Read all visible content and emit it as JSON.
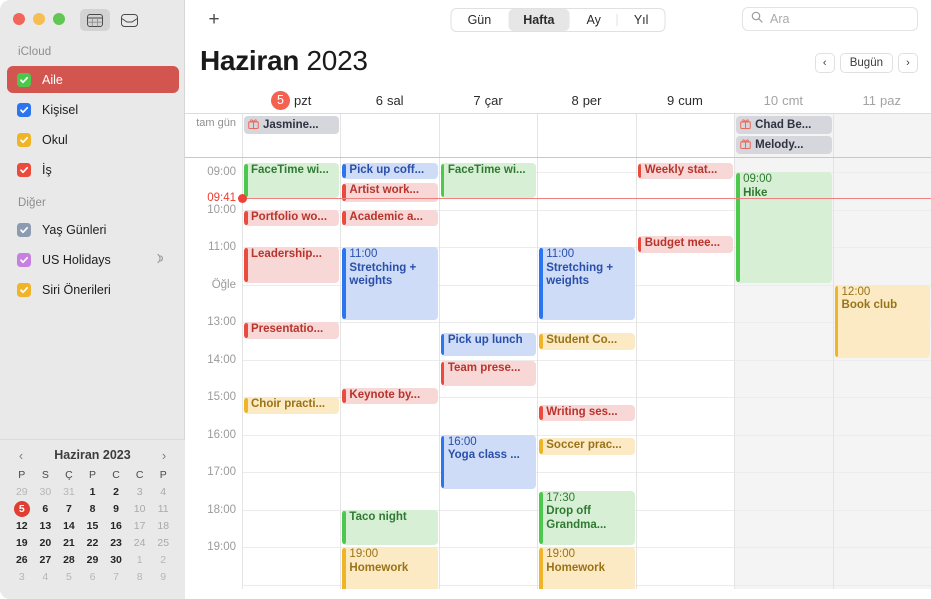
{
  "window": {
    "traffic_lights": [
      "close",
      "minimize",
      "zoom"
    ],
    "toolbar_buttons": [
      "calendar-view-icon",
      "inbox-icon"
    ]
  },
  "sidebar": {
    "sections": [
      {
        "title": "iCloud",
        "items": [
          {
            "label": "Aile",
            "color": "#4cc94c",
            "checked": true,
            "selected": true
          },
          {
            "label": "Kişisel",
            "color": "#2b76f0",
            "checked": true,
            "selected": false
          },
          {
            "label": "Okul",
            "color": "#f0b429",
            "checked": true,
            "selected": false
          },
          {
            "label": "İş",
            "color": "#ea4b3c",
            "checked": true,
            "selected": false
          }
        ]
      },
      {
        "title": "Diğer",
        "items": [
          {
            "label": "Yaş Günleri",
            "color": "#8c9bb0",
            "checked": true,
            "selected": false
          },
          {
            "label": "US Holidays",
            "color": "#c77fe0",
            "checked": true,
            "selected": false,
            "badge": "broadcast-icon"
          },
          {
            "label": "Siri Önerileri",
            "color": "#f0b429",
            "checked": true,
            "selected": false
          }
        ]
      }
    ]
  },
  "mini_calendar": {
    "title": "Haziran 2023",
    "prev": "‹",
    "next": "›",
    "dow": [
      "P",
      "S",
      "Ç",
      "P",
      "C",
      "C",
      "P"
    ],
    "weeks": [
      [
        {
          "d": "29",
          "s": "out"
        },
        {
          "d": "30",
          "s": "out"
        },
        {
          "d": "31",
          "s": "out"
        },
        {
          "d": "1",
          "s": "in"
        },
        {
          "d": "2",
          "s": "in"
        },
        {
          "d": "3",
          "s": "dim"
        },
        {
          "d": "4",
          "s": "dim"
        }
      ],
      [
        {
          "d": "5",
          "s": "today"
        },
        {
          "d": "6",
          "s": "in"
        },
        {
          "d": "7",
          "s": "in"
        },
        {
          "d": "8",
          "s": "in"
        },
        {
          "d": "9",
          "s": "in"
        },
        {
          "d": "10",
          "s": "dim"
        },
        {
          "d": "11",
          "s": "dim"
        }
      ],
      [
        {
          "d": "12",
          "s": "in"
        },
        {
          "d": "13",
          "s": "in"
        },
        {
          "d": "14",
          "s": "in"
        },
        {
          "d": "15",
          "s": "in"
        },
        {
          "d": "16",
          "s": "in"
        },
        {
          "d": "17",
          "s": "dim"
        },
        {
          "d": "18",
          "s": "dim"
        }
      ],
      [
        {
          "d": "19",
          "s": "in"
        },
        {
          "d": "20",
          "s": "in"
        },
        {
          "d": "21",
          "s": "in"
        },
        {
          "d": "22",
          "s": "in"
        },
        {
          "d": "23",
          "s": "in"
        },
        {
          "d": "24",
          "s": "dim"
        },
        {
          "d": "25",
          "s": "dim"
        }
      ],
      [
        {
          "d": "26",
          "s": "in"
        },
        {
          "d": "27",
          "s": "in"
        },
        {
          "d": "28",
          "s": "in"
        },
        {
          "d": "29",
          "s": "in"
        },
        {
          "d": "30",
          "s": "in"
        },
        {
          "d": "1",
          "s": "out"
        },
        {
          "d": "2",
          "s": "out"
        }
      ],
      [
        {
          "d": "3",
          "s": "out"
        },
        {
          "d": "4",
          "s": "out"
        },
        {
          "d": "5",
          "s": "out"
        },
        {
          "d": "6",
          "s": "out"
        },
        {
          "d": "7",
          "s": "out"
        },
        {
          "d": "8",
          "s": "out"
        },
        {
          "d": "9",
          "s": "out"
        }
      ]
    ]
  },
  "toolbar": {
    "add_label": "+",
    "views": [
      {
        "label": "Gün",
        "active": false
      },
      {
        "label": "Hafta",
        "active": true
      },
      {
        "label": "Ay",
        "active": false
      },
      {
        "label": "Yıl",
        "active": false
      }
    ],
    "search_placeholder": "Ara"
  },
  "header": {
    "month": "Haziran",
    "year": "2023",
    "prev_label": "‹",
    "today_label": "Bugün",
    "next_label": "›"
  },
  "days": [
    {
      "num": "5",
      "name": "pzt",
      "today": true,
      "weekend": false
    },
    {
      "num": "6",
      "name": "sal",
      "today": false,
      "weekend": false
    },
    {
      "num": "7",
      "name": "çar",
      "today": false,
      "weekend": false
    },
    {
      "num": "8",
      "name": "per",
      "today": false,
      "weekend": false
    },
    {
      "num": "9",
      "name": "cum",
      "today": false,
      "weekend": false
    },
    {
      "num": "10",
      "name": "cmt",
      "today": false,
      "weekend": true
    },
    {
      "num": "11",
      "name": "paz",
      "today": false,
      "weekend": true
    }
  ],
  "allday": {
    "label": "tam gün",
    "events": [
      {
        "day": 0,
        "name": "Jasmine...",
        "icon": "gift-icon"
      },
      {
        "day": 5,
        "name": "Chad Be...",
        "icon": "gift-icon"
      },
      {
        "day": 5,
        "name": "Melody...",
        "icon": "gift-icon"
      }
    ]
  },
  "grid": {
    "hours": [
      "09:00",
      "10:00",
      "11:00",
      "Öğle",
      "13:00",
      "14:00",
      "15:00",
      "16:00",
      "17:00",
      "18:00",
      "19:00"
    ],
    "now_label": "09:41",
    "now_time": 9.683
  },
  "colors": {
    "red_fill": "#f8d7d7",
    "red_bar": "#ea4b3c",
    "red_text": "#b8342c",
    "blue_fill": "#cedcf7",
    "blue_bar": "#2b76f0",
    "blue_text": "#2a4fa8",
    "green_fill": "#d7f0d5",
    "green_bar": "#4cc94c",
    "green_text": "#2f7a32",
    "yellow_fill": "#fbeac3",
    "yellow_bar": "#f0b429",
    "yellow_text": "#9a7318",
    "now": "#ef3b31",
    "today": "#f4614f",
    "selected": "#d2564f"
  },
  "events": [
    {
      "day": 0,
      "start": 8.75,
      "end": 9.75,
      "name": "FaceTime wi...",
      "time": "",
      "color": "green",
      "compact": true
    },
    {
      "day": 0,
      "start": 10.0,
      "end": 10.5,
      "name": "Portfolio wo...",
      "time": "",
      "color": "red",
      "compact": true
    },
    {
      "day": 0,
      "start": 11.0,
      "end": 12.0,
      "name": "Leadership...",
      "time": "",
      "color": "red",
      "compact": true
    },
    {
      "day": 0,
      "start": 13.0,
      "end": 13.5,
      "name": "Presentatio...",
      "time": "",
      "color": "red",
      "compact": true
    },
    {
      "day": 0,
      "start": 15.0,
      "end": 15.5,
      "name": "Choir practi...",
      "time": "",
      "color": "yellow",
      "compact": true
    },
    {
      "day": 1,
      "start": 8.75,
      "end": 9.25,
      "name": "Pick up coff...",
      "time": "",
      "color": "blue",
      "compact": true
    },
    {
      "day": 1,
      "start": 9.3,
      "end": 9.85,
      "name": "Artist work...",
      "time": "",
      "color": "red",
      "compact": true
    },
    {
      "day": 1,
      "start": 10.0,
      "end": 10.5,
      "name": "Academic a...",
      "time": "",
      "color": "red",
      "compact": true
    },
    {
      "day": 1,
      "start": 11.0,
      "end": 13.0,
      "name": "Stretching + weights",
      "time": "11:00",
      "color": "blue",
      "compact": false
    },
    {
      "day": 1,
      "start": 14.75,
      "end": 15.25,
      "name": "Keynote by...",
      "time": "",
      "color": "red",
      "compact": true
    },
    {
      "day": 1,
      "start": 18.0,
      "end": 19.0,
      "name": "Taco night",
      "time": "",
      "color": "green",
      "compact": true
    },
    {
      "day": 1,
      "start": 19.0,
      "end": 20.3,
      "name": "Homework",
      "time": "19:00",
      "color": "yellow",
      "compact": false
    },
    {
      "day": 2,
      "start": 8.75,
      "end": 9.75,
      "name": "FaceTime wi...",
      "time": "",
      "color": "green",
      "compact": true
    },
    {
      "day": 2,
      "start": 13.3,
      "end": 13.95,
      "name": "Pick up lunch",
      "time": "",
      "color": "blue",
      "compact": true
    },
    {
      "day": 2,
      "start": 14.05,
      "end": 14.75,
      "name": "Team prese...",
      "time": "",
      "color": "red",
      "compact": true
    },
    {
      "day": 2,
      "start": 16.0,
      "end": 17.5,
      "name": "Yoga class  ...",
      "time": "16:00",
      "color": "blue",
      "compact": false
    },
    {
      "day": 3,
      "start": 11.0,
      "end": 13.0,
      "name": "Stretching + weights",
      "time": "11:00",
      "color": "blue",
      "compact": false
    },
    {
      "day": 3,
      "start": 13.3,
      "end": 13.8,
      "name": "Student Co...",
      "time": "",
      "color": "yellow",
      "compact": true
    },
    {
      "day": 3,
      "start": 15.2,
      "end": 15.7,
      "name": "Writing ses...",
      "time": "",
      "color": "red",
      "compact": true
    },
    {
      "day": 3,
      "start": 16.1,
      "end": 16.6,
      "name": "Soccer prac...",
      "time": "",
      "color": "yellow",
      "compact": true
    },
    {
      "day": 3,
      "start": 17.5,
      "end": 19.0,
      "name": "Drop off Grandma...",
      "time": "17:30",
      "color": "green",
      "compact": false
    },
    {
      "day": 3,
      "start": 19.0,
      "end": 20.3,
      "name": "Homework",
      "time": "19:00",
      "color": "yellow",
      "compact": false
    },
    {
      "day": 4,
      "start": 8.75,
      "end": 9.25,
      "name": "Weekly stat...",
      "time": "",
      "color": "red",
      "compact": true
    },
    {
      "day": 4,
      "start": 10.7,
      "end": 11.2,
      "name": "Budget mee...",
      "time": "",
      "color": "red",
      "compact": true
    },
    {
      "day": 5,
      "start": 9.0,
      "end": 12.0,
      "name": "Hike",
      "time": "09:00",
      "color": "green",
      "compact": false
    },
    {
      "day": 6,
      "start": 12.0,
      "end": 14.0,
      "name": "Book club",
      "time": "12:00",
      "color": "yellow",
      "compact": false
    }
  ]
}
